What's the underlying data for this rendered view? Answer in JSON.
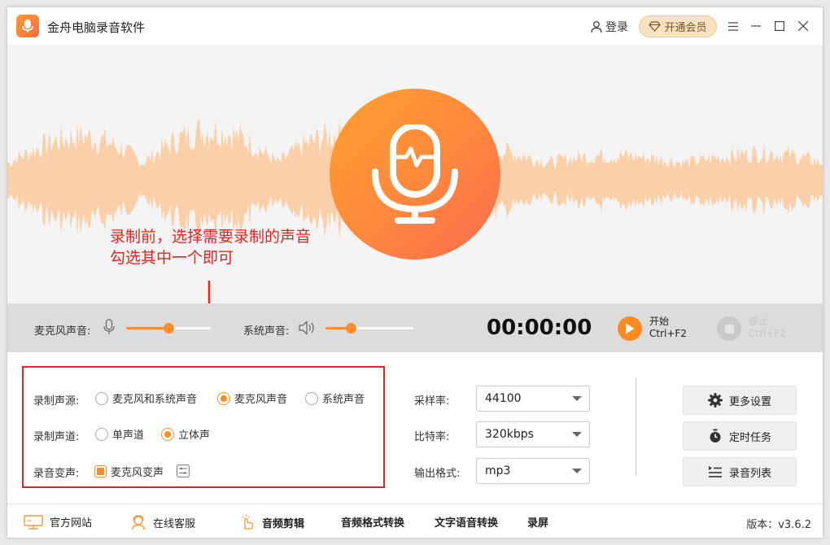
{
  "app": {
    "title": "金舟电脑录音软件",
    "login_label": "登录",
    "vip_label": "开通会员"
  },
  "annotation": {
    "line1": "录制前，选择需要录制的声音",
    "line2": "勾选其中一个即可"
  },
  "controls": {
    "mic_volume_label": "麦克风声音:",
    "mic_volume_level": 0.5,
    "system_volume_label": "系统声音:",
    "system_volume_level": 0.29,
    "timer": "00:00:00",
    "start_label": "开始",
    "start_shortcut": "Ctrl+F2",
    "stop_label": "停止",
    "stop_shortcut": "Ctrl+F2"
  },
  "settings": {
    "source_label": "录制声源:",
    "source_options": [
      "麦克风和系统声音",
      "麦克风声音",
      "系统声音"
    ],
    "source_selected": "麦克风声音",
    "channel_label": "录制声道:",
    "channel_options": [
      "单声道",
      "立体声"
    ],
    "channel_selected": "立体声",
    "voice_change_label": "录音变声:",
    "voice_change_option": "麦克风变声",
    "sample_rate_label": "采样率:",
    "sample_rate_value": "44100",
    "bitrate_label": "比特率:",
    "bitrate_value": "320kbps",
    "format_label": "输出格式:",
    "format_value": "mp3",
    "more_settings": "更多设置",
    "scheduled_task": "定时任务",
    "recording_list": "录音列表"
  },
  "footer": {
    "website": "官方网站",
    "online_service": "在线客服",
    "audio_edit": "音频剪辑",
    "format_convert": "音频格式转换",
    "tts": "文字语音转换",
    "screen_record": "录屏",
    "version": "版本：v3.6.2"
  },
  "colors": {
    "accent": "#ff8c2b",
    "annotation_red": "#e8231f",
    "wave": "#fbc89a"
  }
}
